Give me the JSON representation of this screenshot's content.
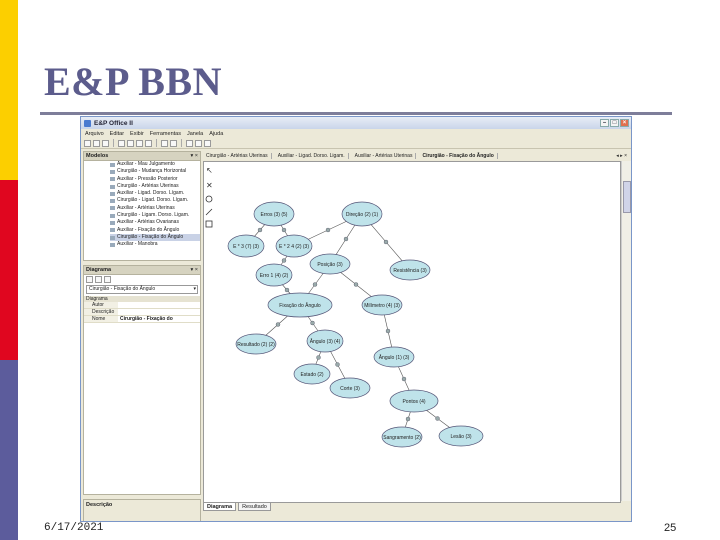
{
  "slide": {
    "title": "E&P BBN",
    "date": "6/17/2021",
    "page": "25"
  },
  "colors": {
    "stripe_yellow": "#fccf00",
    "stripe_red": "#e0061f",
    "stripe_blue": "#5c5c9c",
    "title": "#5c5c8c",
    "node_fill": "#bfe3ea"
  },
  "app": {
    "window_title": "E&P Office II",
    "menu": [
      "Arquivo",
      "Editar",
      "Exibir",
      "Ferramentas",
      "Janela",
      "Ajuda"
    ],
    "models_panel": {
      "title": "Modelos",
      "items": [
        "Auxiliar - Mau Julgamento",
        "Cirurgião - Mudança Horizontal",
        "Auxiliar - Pressão Posterior",
        "Cirurgião - Artérias Uterinas",
        "Auxiliar - Ligad. Dorso. Lígam.",
        "Cirurgião - Ligad. Dorso. Lígam.",
        "Auxiliar - Artérias Uterinas",
        "Cirurgião - Ligam. Dorso. Ligam.",
        "Auxiliar - Artérias Ovarianas",
        "Auxiliar - Fixação do Ângulo",
        "Cirurgião - Fixação do Ângulo",
        "Auxiliar - Manobra"
      ],
      "selected_index": 10
    },
    "diagram_panel": {
      "title": "Diagrama",
      "selector": "Cirurgião - Fixação do Ângulo",
      "section": "Diagrama",
      "props": [
        {
          "key": "Autor",
          "value": ""
        },
        {
          "key": "Descrição",
          "value": ""
        },
        {
          "key": "Nome",
          "value": "Cirurgião - Fixação do"
        }
      ],
      "description_label": "Descrição"
    },
    "tabs": [
      {
        "label": "Cirurgião - Artérias Uterinas",
        "active": false
      },
      {
        "label": "Auxiliar - Ligad. Dorso. Ligam.",
        "active": false
      },
      {
        "label": "Auxiliar - Artérias Uterinas",
        "active": false
      },
      {
        "label": "Cirurgião - Fixação do Ângulo",
        "active": true
      }
    ],
    "bottom_tabs": [
      {
        "label": "Diagrama",
        "active": true
      },
      {
        "label": "Resultado",
        "active": false
      }
    ],
    "nodes": [
      {
        "id": "n1",
        "label": "Erros (3) (5)"
      },
      {
        "id": "n2",
        "label": "Direção (2) (1)"
      },
      {
        "id": "n3",
        "label": "E * 3 (7) (3)"
      },
      {
        "id": "n4",
        "label": "E * 2 4 (2) (3)"
      },
      {
        "id": "n5",
        "label": "Erro 1 (4) (2)"
      },
      {
        "id": "n6",
        "label": "Posição (3)"
      },
      {
        "id": "n7",
        "label": "Resistência (3)"
      },
      {
        "id": "n8",
        "label": "Fixação do Ângulo"
      },
      {
        "id": "n9",
        "label": "Milímetro (4) (3)"
      },
      {
        "id": "n10",
        "label": "Resultado (2) (2)"
      },
      {
        "id": "n11",
        "label": "Ângulo (3) (4)"
      },
      {
        "id": "n12",
        "label": "Ângulo (1) (3)"
      },
      {
        "id": "n13",
        "label": "Estado (2)"
      },
      {
        "id": "n14",
        "label": "Corte (3)"
      },
      {
        "id": "n15",
        "label": "Pontos (4)"
      },
      {
        "id": "n16",
        "label": "Sangramento (2)"
      },
      {
        "id": "n17",
        "label": "Lesão (3)"
      }
    ]
  }
}
